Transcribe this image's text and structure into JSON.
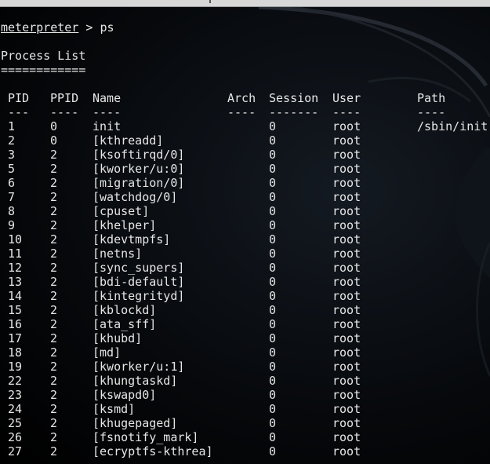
{
  "window": {
    "title": ""
  },
  "prompt": {
    "label": "meterpreter",
    "separator": " > ",
    "command": "ps"
  },
  "heading": {
    "title": "Process List",
    "underline": "============"
  },
  "table": {
    "headers": {
      "pid": "PID",
      "ppid": "PPID",
      "name": "Name",
      "arch": "Arch",
      "session": "Session",
      "user": "User",
      "path": "Path"
    },
    "separators": {
      "pid": "---",
      "ppid": "----",
      "name": "----",
      "arch": "----",
      "session": "-------",
      "user": "----",
      "path": "----"
    },
    "rows": [
      {
        "pid": "1",
        "ppid": "0",
        "name": "init",
        "arch": "",
        "session": "0",
        "user": "root",
        "path": "/sbin/init"
      },
      {
        "pid": "2",
        "ppid": "0",
        "name": "[kthreadd]",
        "arch": "",
        "session": "0",
        "user": "root",
        "path": ""
      },
      {
        "pid": "3",
        "ppid": "2",
        "name": "[ksoftirqd/0]",
        "arch": "",
        "session": "0",
        "user": "root",
        "path": ""
      },
      {
        "pid": "5",
        "ppid": "2",
        "name": "[kworker/u:0]",
        "arch": "",
        "session": "0",
        "user": "root",
        "path": ""
      },
      {
        "pid": "6",
        "ppid": "2",
        "name": "[migration/0]",
        "arch": "",
        "session": "0",
        "user": "root",
        "path": ""
      },
      {
        "pid": "7",
        "ppid": "2",
        "name": "[watchdog/0]",
        "arch": "",
        "session": "0",
        "user": "root",
        "path": ""
      },
      {
        "pid": "8",
        "ppid": "2",
        "name": "[cpuset]",
        "arch": "",
        "session": "0",
        "user": "root",
        "path": ""
      },
      {
        "pid": "9",
        "ppid": "2",
        "name": "[khelper]",
        "arch": "",
        "session": "0",
        "user": "root",
        "path": ""
      },
      {
        "pid": "10",
        "ppid": "2",
        "name": "[kdevtmpfs]",
        "arch": "",
        "session": "0",
        "user": "root",
        "path": ""
      },
      {
        "pid": "11",
        "ppid": "2",
        "name": "[netns]",
        "arch": "",
        "session": "0",
        "user": "root",
        "path": ""
      },
      {
        "pid": "12",
        "ppid": "2",
        "name": "[sync_supers]",
        "arch": "",
        "session": "0",
        "user": "root",
        "path": ""
      },
      {
        "pid": "13",
        "ppid": "2",
        "name": "[bdi-default]",
        "arch": "",
        "session": "0",
        "user": "root",
        "path": ""
      },
      {
        "pid": "14",
        "ppid": "2",
        "name": "[kintegrityd]",
        "arch": "",
        "session": "0",
        "user": "root",
        "path": ""
      },
      {
        "pid": "15",
        "ppid": "2",
        "name": "[kblockd]",
        "arch": "",
        "session": "0",
        "user": "root",
        "path": ""
      },
      {
        "pid": "16",
        "ppid": "2",
        "name": "[ata_sff]",
        "arch": "",
        "session": "0",
        "user": "root",
        "path": ""
      },
      {
        "pid": "17",
        "ppid": "2",
        "name": "[khubd]",
        "arch": "",
        "session": "0",
        "user": "root",
        "path": ""
      },
      {
        "pid": "18",
        "ppid": "2",
        "name": "[md]",
        "arch": "",
        "session": "0",
        "user": "root",
        "path": ""
      },
      {
        "pid": "19",
        "ppid": "2",
        "name": "[kworker/u:1]",
        "arch": "",
        "session": "0",
        "user": "root",
        "path": ""
      },
      {
        "pid": "22",
        "ppid": "2",
        "name": "[khungtaskd]",
        "arch": "",
        "session": "0",
        "user": "root",
        "path": ""
      },
      {
        "pid": "23",
        "ppid": "2",
        "name": "[kswapd0]",
        "arch": "",
        "session": "0",
        "user": "root",
        "path": ""
      },
      {
        "pid": "24",
        "ppid": "2",
        "name": "[ksmd]",
        "arch": "",
        "session": "0",
        "user": "root",
        "path": ""
      },
      {
        "pid": "25",
        "ppid": "2",
        "name": "[khugepaged]",
        "arch": "",
        "session": "0",
        "user": "root",
        "path": ""
      },
      {
        "pid": "26",
        "ppid": "2",
        "name": "[fsnotify_mark]",
        "arch": "",
        "session": "0",
        "user": "root",
        "path": ""
      },
      {
        "pid": "27",
        "ppid": "2",
        "name": "[ecryptfs-kthrea]",
        "arch": "",
        "session": "0",
        "user": "root",
        "path": ""
      }
    ]
  },
  "colors": {
    "background": "#000000",
    "text": "#e6e6e6",
    "topbar": "#d7d7d7"
  }
}
